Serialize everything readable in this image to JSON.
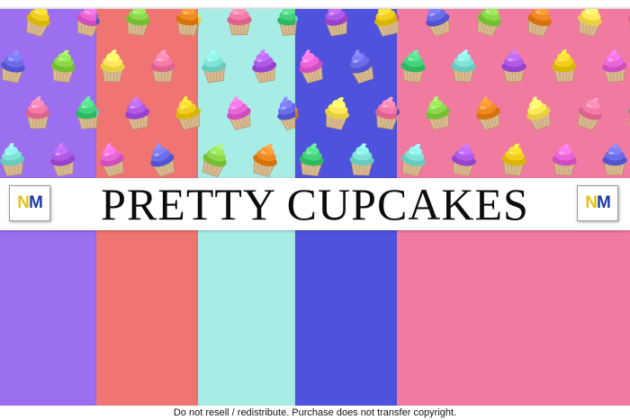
{
  "banner": {
    "title": "PRETTY CUPCAKES"
  },
  "logo": {
    "letter_n": "N",
    "letter_m": "M"
  },
  "footer": {
    "notice": "Do not resell / redistribute. Purchase does not transfer copyright."
  },
  "papers": [
    {
      "name": "purple",
      "color": "#9b6ff0"
    },
    {
      "name": "coral",
      "color": "#ef7472"
    },
    {
      "name": "mint",
      "color": "#a8ece6"
    },
    {
      "name": "blue",
      "color": "#4f52dd"
    },
    {
      "name": "pink",
      "color": "#f07aa0"
    }
  ],
  "frosting_colors": [
    "#b05ae8",
    "#f2cf1e",
    "#ea66d8",
    "#6b6de8",
    "#8cd84a",
    "#f08a22",
    "#ffe95a",
    "#f77ba8",
    "#44d27c",
    "#7fe3d8"
  ],
  "wrapper_color": "#d9b98e"
}
